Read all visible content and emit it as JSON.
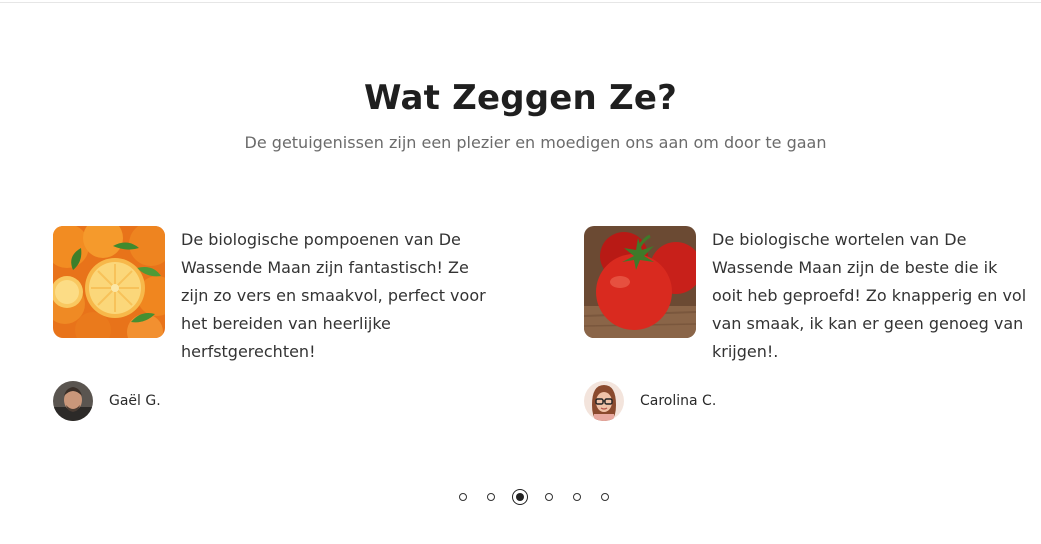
{
  "section": {
    "title": "Wat Zeggen Ze?",
    "subtitle": "De getuigenissen zijn een plezier en moedigen ons aan om door te gaan"
  },
  "testimonials": [
    {
      "image_icon": "oranges-photo",
      "quote": "De biologische pompoenen van De Wassende Maan zijn fantastisch! Ze zijn zo vers en smaakvol, perfect voor het bereiden van heerlijke herfstgerechten!",
      "author": "Gaël G."
    },
    {
      "image_icon": "tomatoes-photo",
      "quote": "De biologische wortelen van De Wassende Maan zijn de beste die ik ooit heb geproefd! Zo knapperig en vol van smaak, ik kan er geen genoeg van krijgen!.",
      "author": "Carolina C."
    }
  ],
  "pagination": {
    "count": 6,
    "active_index": 2
  },
  "colors": {
    "heading": "#1f1f1f",
    "subtitle": "#6b6b6b",
    "body_text": "#333333"
  }
}
